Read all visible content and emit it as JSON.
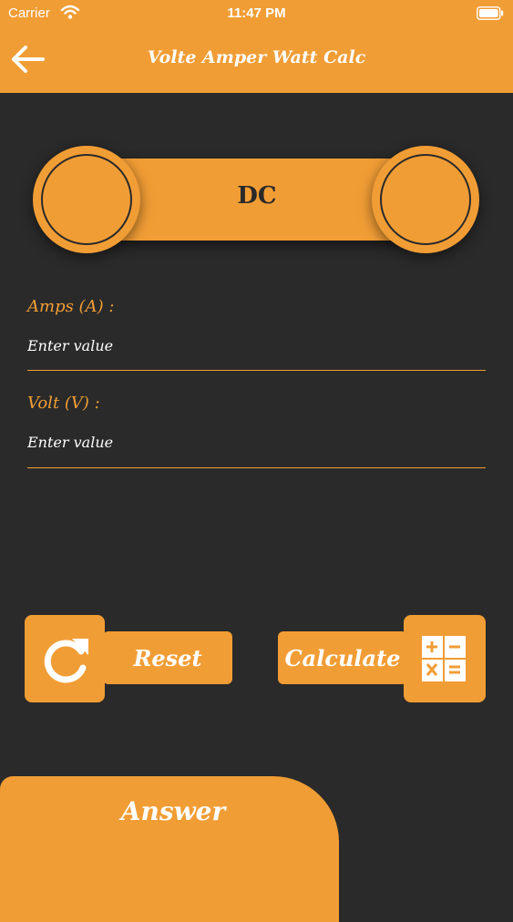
{
  "status_bar": {
    "carrier": "Carrier",
    "time": "11:47 PM",
    "icons": [
      "wifi-icon",
      "battery-icon"
    ]
  },
  "nav": {
    "title": "Volte Amper Watt Calc",
    "back_icon": "arrow-left-icon"
  },
  "mode_toggle": {
    "label": "DC"
  },
  "fields": [
    {
      "label": "Amps (A) :",
      "placeholder": "Enter value",
      "value": ""
    },
    {
      "label": "Volt (V) :",
      "placeholder": "Enter value",
      "value": ""
    }
  ],
  "buttons": {
    "reset_label": "Reset",
    "reset_icon": "refresh-icon",
    "calculate_label": "Calculate",
    "calculate_icon": "calculator-icon"
  },
  "answer": {
    "label": "Answer"
  },
  "colors": {
    "accent": "#f19d35",
    "background": "#2a2a2a",
    "text": "#ffffff"
  }
}
